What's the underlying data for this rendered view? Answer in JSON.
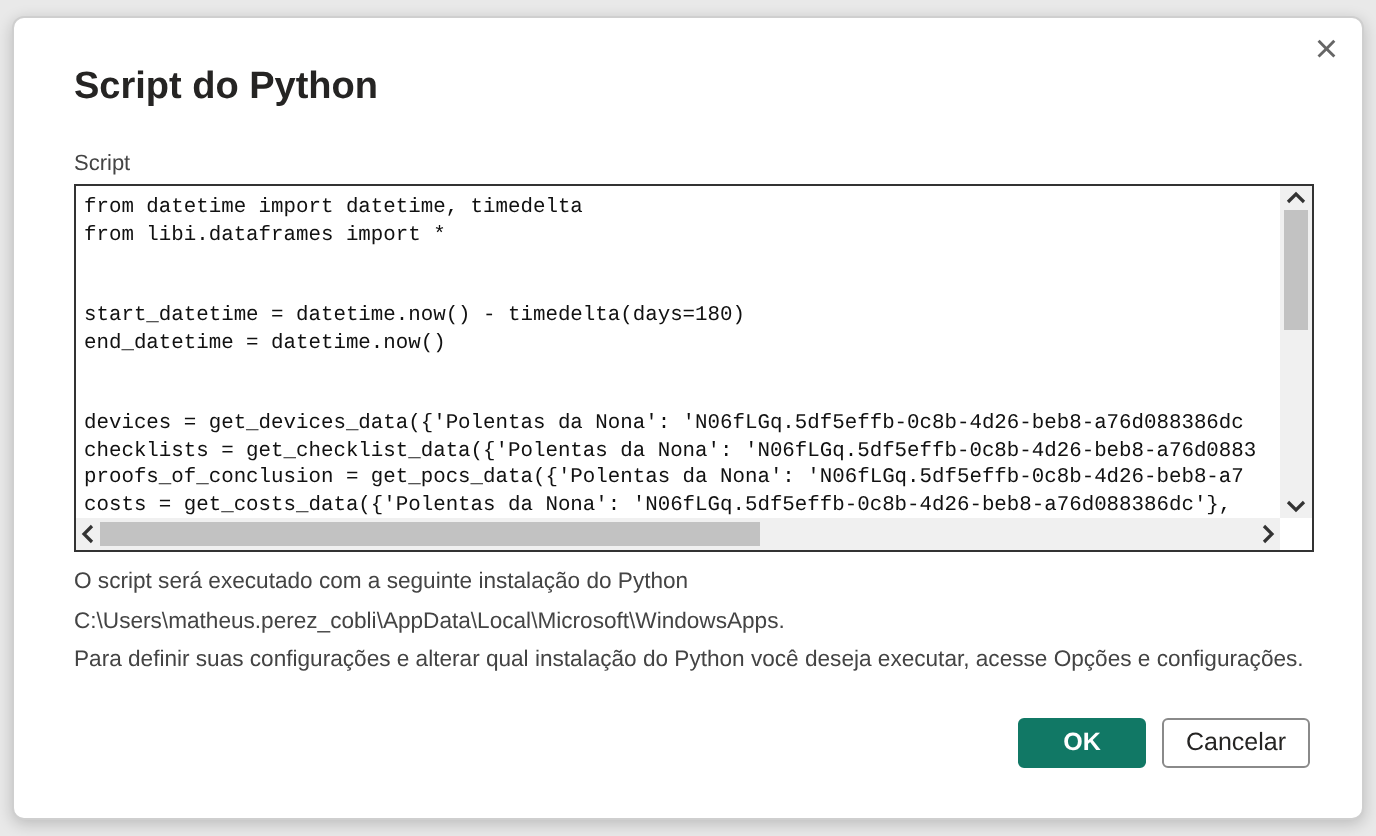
{
  "dialog": {
    "title": "Script do Python",
    "close_label": "×"
  },
  "script_field": {
    "label": "Script",
    "line_groups": [
      [
        "from datetime import datetime, timedelta",
        "from libi.dataframes import *"
      ],
      [
        "start_datetime = datetime.now() - timedelta(days=180)",
        "end_datetime = datetime.now()"
      ],
      [
        "devices = get_devices_data({'Polentas da Nona': 'N06fLGq.5df5effb-0c8b-4d26-beb8-a76d088386dc",
        "checklists = get_checklist_data({'Polentas da Nona': 'N06fLGq.5df5effb-0c8b-4d26-beb8-a76d0883",
        "proofs_of_conclusion = get_pocs_data({'Polentas da Nona': 'N06fLGq.5df5effb-0c8b-4d26-beb8-a7",
        "costs = get_costs_data({'Polentas da Nona': 'N06fLGq.5df5effb-0c8b-4d26-beb8-a76d088386dc'},"
      ]
    ]
  },
  "info": [
    "O script será executado com a seguinte instalação do Python",
    "C:\\Users\\matheus.perez_cobli\\AppData\\Local\\Microsoft\\WindowsApps.",
    "Para definir suas configurações e alterar qual instalação do Python você deseja executar, acesse Opções e configurações."
  ],
  "buttons": [
    {
      "label": "OK",
      "kind": "primary"
    },
    {
      "label": "Cancelar",
      "kind": "secondary"
    }
  ]
}
